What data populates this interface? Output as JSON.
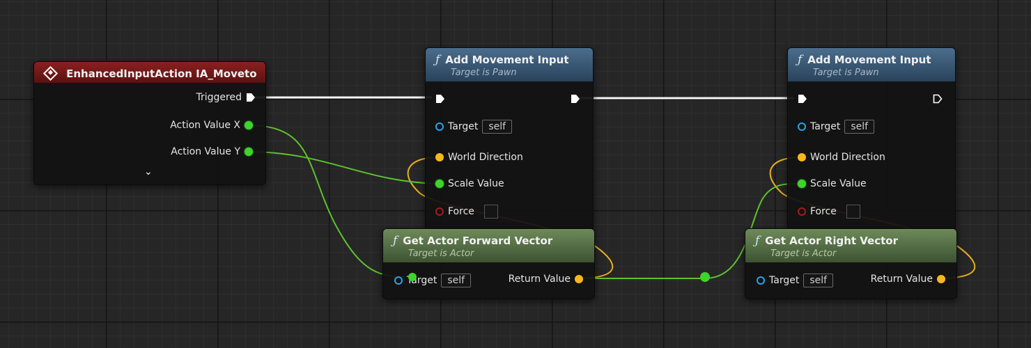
{
  "input_node": {
    "title": "EnhancedInputAction IA_Moveto",
    "pins": {
      "triggered": "Triggered",
      "action_x": "Action Value X",
      "action_y": "Action Value Y"
    }
  },
  "add_movement_1": {
    "title": "Add Movement Input",
    "subtitle": "Target is Pawn",
    "pins": {
      "target": "Target",
      "target_value": "self",
      "world_direction": "World Direction",
      "scale_value": "Scale Value",
      "force": "Force"
    }
  },
  "add_movement_2": {
    "title": "Add Movement Input",
    "subtitle": "Target is Pawn",
    "pins": {
      "target": "Target",
      "target_value": "self",
      "world_direction": "World Direction",
      "scale_value": "Scale Value",
      "force": "Force"
    }
  },
  "forward_vector": {
    "title": "Get Actor Forward Vector",
    "subtitle": "Target is Actor",
    "pins": {
      "target": "Target",
      "target_value": "self",
      "return_value": "Return Value"
    }
  },
  "right_vector": {
    "title": "Get Actor Right Vector",
    "subtitle": "Target is Actor",
    "pins": {
      "target": "Target",
      "target_value": "self",
      "return_value": "Return Value"
    }
  },
  "colors": {
    "exec_wire": "#ffffff",
    "float_wire": "#5ec22e",
    "vector_wire": "#e8b020",
    "input_header": "#8c1f1f",
    "function_header": "#4a6d8c",
    "pure_header": "#6e8a5a"
  },
  "icons": {
    "function": "function-icon",
    "event": "diamond-icon",
    "expand": "chevron-down-icon"
  }
}
